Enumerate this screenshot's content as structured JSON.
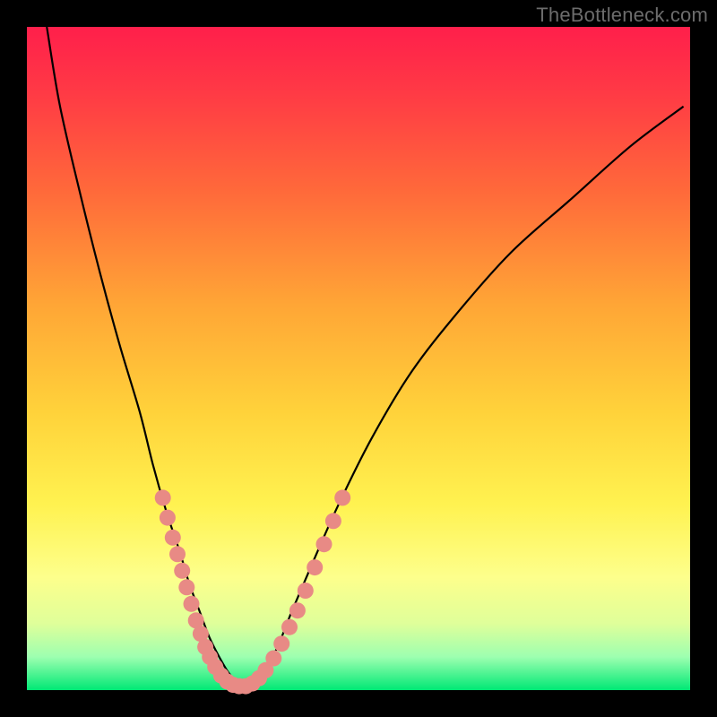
{
  "watermark": "TheBottleneck.com",
  "colors": {
    "frame": "#000000",
    "curve": "#000000",
    "marker_fill": "#e88a85",
    "marker_stroke": "#e88a85"
  },
  "chart_data": {
    "type": "line",
    "title": "",
    "xlabel": "",
    "ylabel": "",
    "xlim": [
      0,
      100
    ],
    "ylim": [
      0,
      100
    ],
    "grid": false,
    "legend": false,
    "note": "V-shaped bottleneck curve over vertical red-to-green gradient. Axes are unlabeled; x/y values are read in percent of plot width/height with y=0 at top (so high y = bottom = green = good fit, y=0 = top = red = severe bottleneck).",
    "series": [
      {
        "name": "bottleneck-curve",
        "x": [
          3,
          5,
          8,
          11,
          14,
          17,
          19,
          21,
          23,
          24.5,
          26,
          27.5,
          29,
          30.5,
          32,
          34,
          36,
          38,
          40,
          43,
          47,
          52,
          58,
          65,
          73,
          82,
          91,
          99
        ],
        "y": [
          0,
          12,
          25,
          37,
          48,
          58,
          66,
          73,
          79,
          84,
          88,
          92,
          95,
          97.5,
          99,
          99,
          97,
          93,
          88,
          81,
          72,
          62,
          52,
          43,
          34,
          26,
          18,
          12
        ]
      }
    ],
    "markers": {
      "name": "highlighted-data-points",
      "note": "Dense pink markers clustered near the bottom of the V, approximately where curve is in the green/yellow band (y >= ~72).",
      "points": [
        {
          "x": 20.5,
          "y": 71
        },
        {
          "x": 21.2,
          "y": 74
        },
        {
          "x": 22.0,
          "y": 77
        },
        {
          "x": 22.7,
          "y": 79.5
        },
        {
          "x": 23.4,
          "y": 82
        },
        {
          "x": 24.1,
          "y": 84.5
        },
        {
          "x": 24.8,
          "y": 87
        },
        {
          "x": 25.5,
          "y": 89.5
        },
        {
          "x": 26.2,
          "y": 91.5
        },
        {
          "x": 26.9,
          "y": 93.5
        },
        {
          "x": 27.6,
          "y": 95
        },
        {
          "x": 28.4,
          "y": 96.5
        },
        {
          "x": 29.3,
          "y": 97.8
        },
        {
          "x": 30.2,
          "y": 98.7
        },
        {
          "x": 31.1,
          "y": 99.2
        },
        {
          "x": 32.0,
          "y": 99.4
        },
        {
          "x": 33.0,
          "y": 99.4
        },
        {
          "x": 34.0,
          "y": 99.0
        },
        {
          "x": 35.0,
          "y": 98.2
        },
        {
          "x": 36.0,
          "y": 97.0
        },
        {
          "x": 37.2,
          "y": 95.2
        },
        {
          "x": 38.4,
          "y": 93.0
        },
        {
          "x": 39.6,
          "y": 90.5
        },
        {
          "x": 40.8,
          "y": 88.0
        },
        {
          "x": 42.0,
          "y": 85.0
        },
        {
          "x": 43.4,
          "y": 81.5
        },
        {
          "x": 44.8,
          "y": 78.0
        },
        {
          "x": 46.2,
          "y": 74.5
        },
        {
          "x": 47.6,
          "y": 71.0
        }
      ]
    }
  }
}
